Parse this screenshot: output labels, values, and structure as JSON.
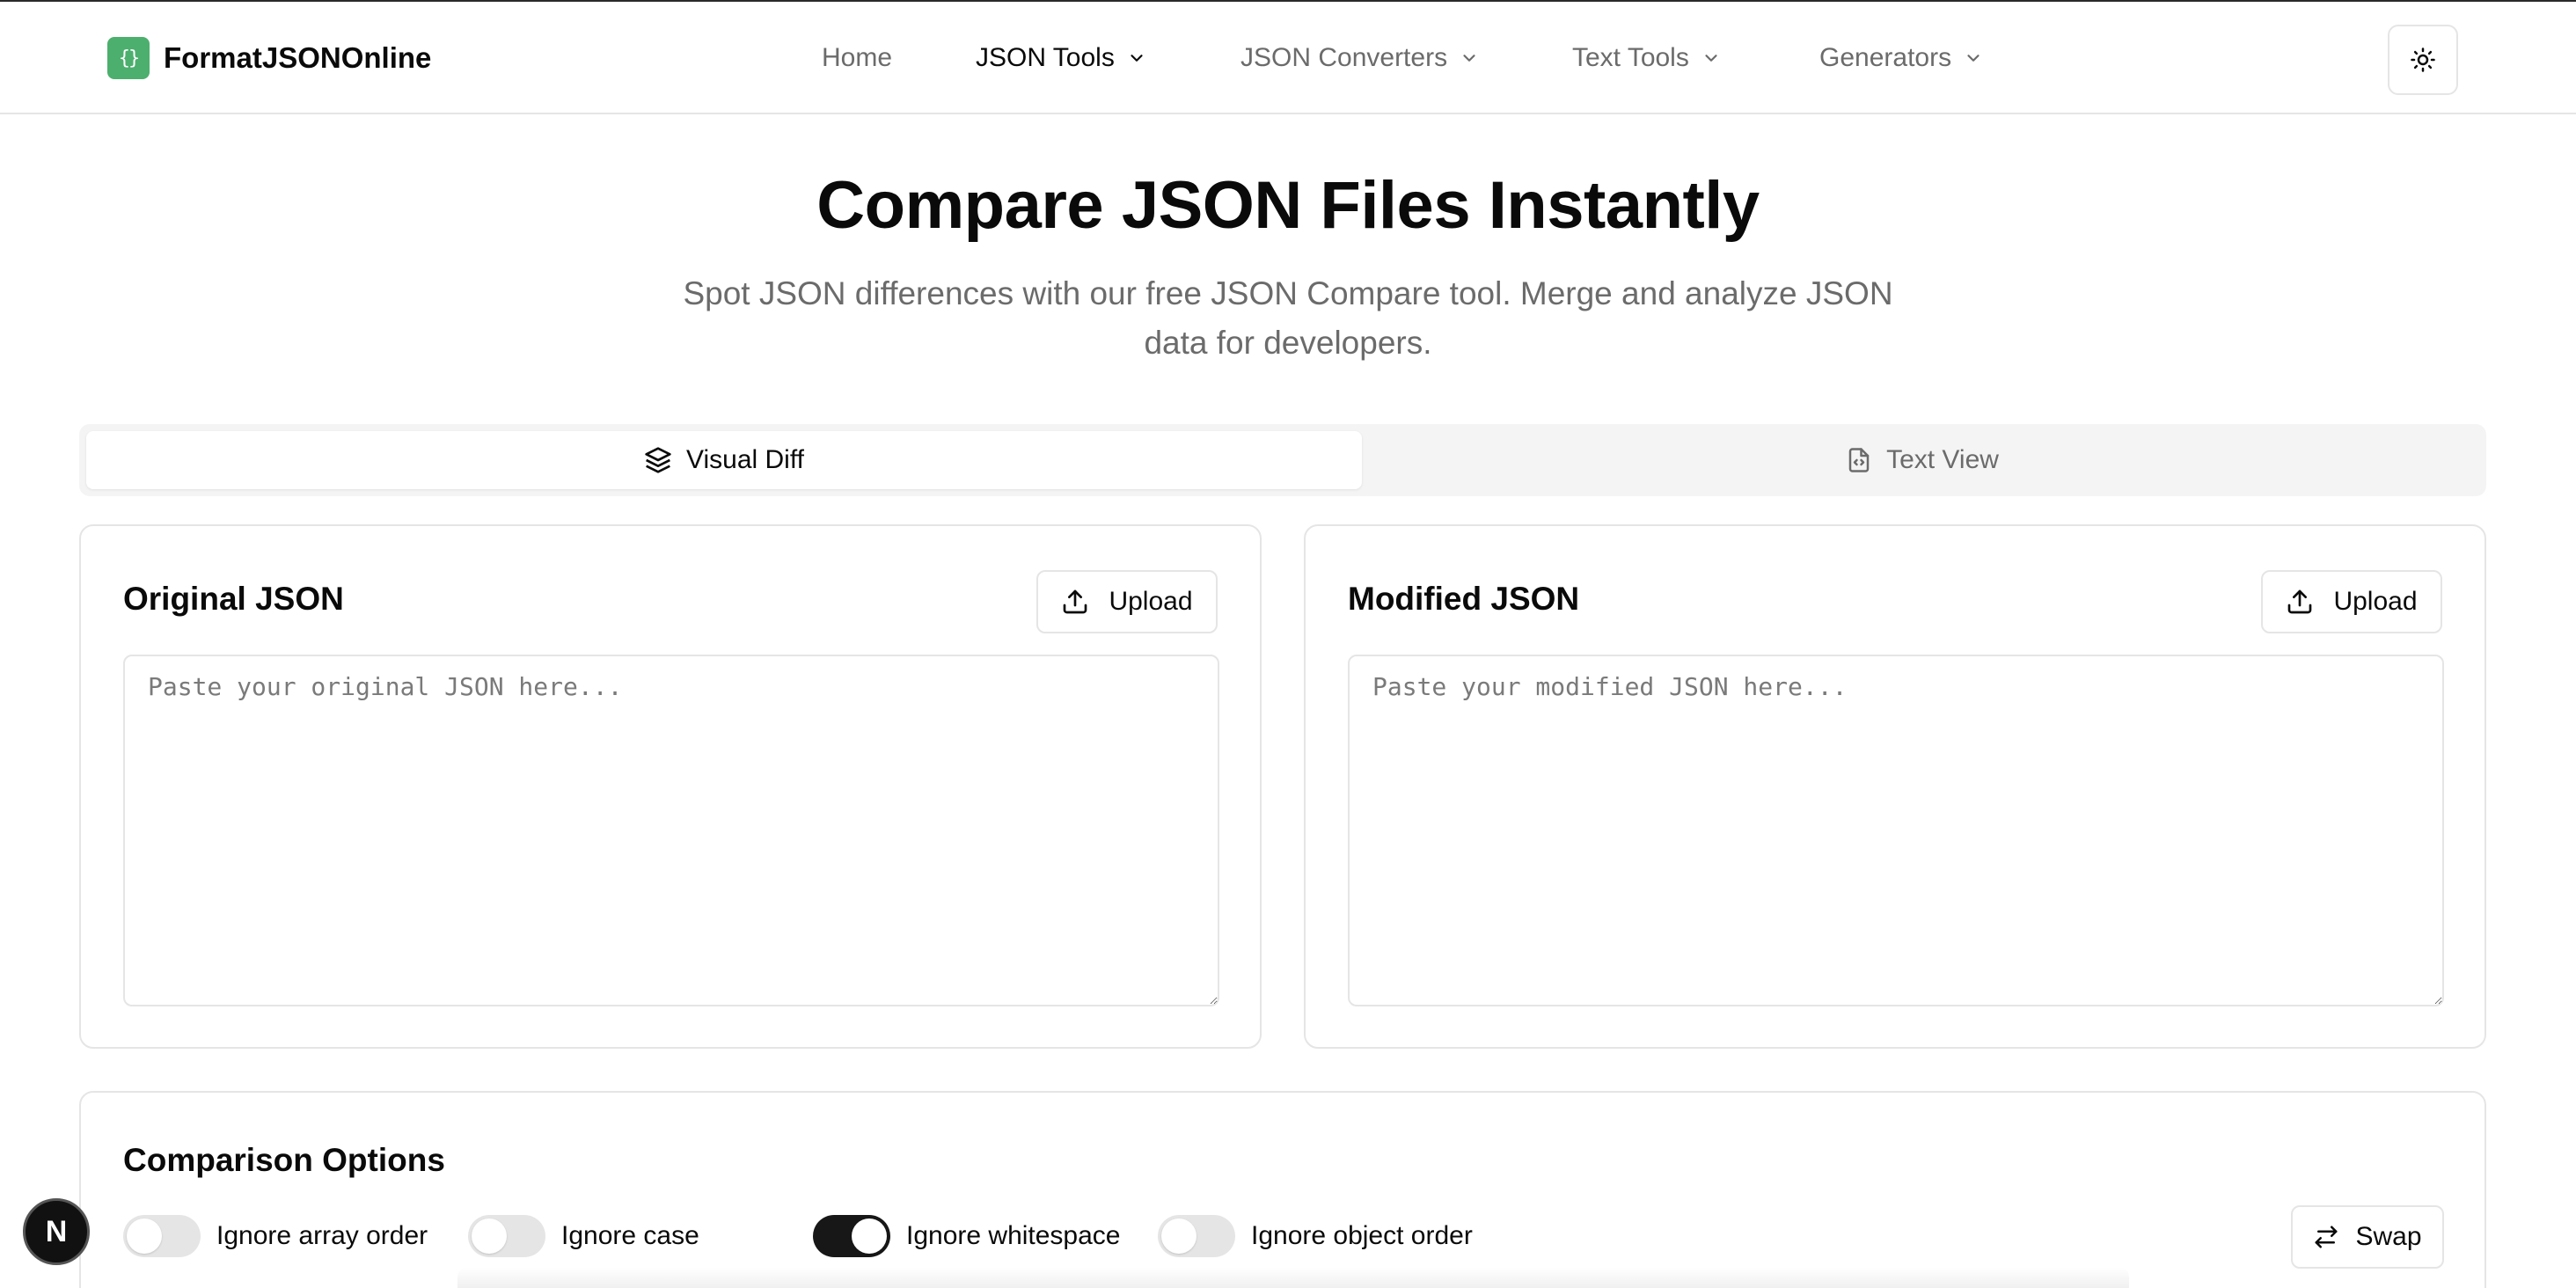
{
  "header": {
    "logo_glyph": "{}",
    "brand": "FormatJSONOnline",
    "nav": [
      {
        "label": "Home",
        "dropdown": false,
        "active": false
      },
      {
        "label": "JSON Tools",
        "dropdown": true,
        "active": true
      },
      {
        "label": "JSON Converters",
        "dropdown": true,
        "active": false
      },
      {
        "label": "Text Tools",
        "dropdown": true,
        "active": false
      },
      {
        "label": "Generators",
        "dropdown": true,
        "active": false
      }
    ],
    "theme_icon": "sun-icon"
  },
  "hero": {
    "title": "Compare JSON Files Instantly",
    "subtitle": "Spot JSON differences with our free JSON Compare tool. Merge and analyze JSON data for developers."
  },
  "tabs": [
    {
      "label": "Visual Diff",
      "icon": "layers-icon",
      "active": true
    },
    {
      "label": "Text View",
      "icon": "file-code-icon",
      "active": false
    }
  ],
  "panels": {
    "original": {
      "title": "Original JSON",
      "upload_label": "Upload",
      "value": "",
      "placeholder": "Paste your original JSON here..."
    },
    "modified": {
      "title": "Modified JSON",
      "upload_label": "Upload",
      "value": "",
      "placeholder": "Paste your modified JSON here..."
    }
  },
  "options": {
    "title": "Comparison Options",
    "toggles": [
      {
        "label": "Ignore array order",
        "on": false
      },
      {
        "label": "Ignore case",
        "on": false
      },
      {
        "label": "Ignore whitespace",
        "on": true
      },
      {
        "label": "Ignore object order",
        "on": false
      }
    ],
    "swap_label": "Swap"
  },
  "badge": {
    "letter": "N"
  },
  "colors": {
    "brand": "#4caf6e",
    "toggle_on": "#171717",
    "border": "#e5e5e5",
    "muted_text": "#6b6b6b"
  }
}
